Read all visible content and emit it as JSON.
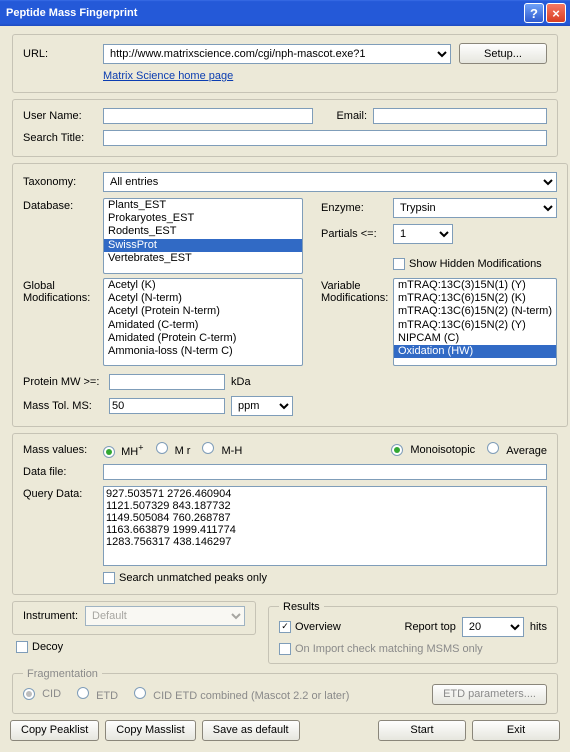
{
  "window": {
    "title": "Peptide Mass Fingerprint",
    "help": "?",
    "close": "×"
  },
  "url": {
    "label": "URL:",
    "value": "http://www.matrixscience.com/cgi/nph-mascot.exe?1",
    "setup": "Setup...",
    "link": "Matrix Science home page"
  },
  "user": {
    "name_label": "User Name:",
    "name_value": "",
    "email_label": "Email:",
    "email_value": "",
    "searchtitle_label": "Search Title:",
    "searchtitle_value": ""
  },
  "taxonomy": {
    "label": "Taxonomy:",
    "value": "All entries"
  },
  "database": {
    "label": "Database:",
    "items": [
      "Plants_EST",
      "Prokaryotes_EST",
      "Rodents_EST",
      "SwissProt",
      "Vertebrates_EST"
    ],
    "selected": "SwissProt"
  },
  "enzyme": {
    "label": "Enzyme:",
    "value": "Trypsin"
  },
  "partials": {
    "label": "Partials <=:",
    "value": "1"
  },
  "showhidden": {
    "label": "Show Hidden Modifications",
    "checked": false
  },
  "globalmods": {
    "label": "Global\nModifications:",
    "items": [
      "Acetyl (K)",
      "Acetyl (N-term)",
      "Acetyl (Protein N-term)",
      "Amidated (C-term)",
      "Amidated (Protein C-term)",
      "Ammonia-loss (N-term C)"
    ]
  },
  "varmods": {
    "label": "Variable\nModifications:",
    "items": [
      "mTRAQ:13C(3)15N(1) (Y)",
      "mTRAQ:13C(6)15N(2) (K)",
      "mTRAQ:13C(6)15N(2) (N-term)",
      "mTRAQ:13C(6)15N(2) (Y)",
      "NIPCAM (C)",
      "Oxidation (HW)"
    ]
  },
  "proteinmw": {
    "label": "Protein MW >=:",
    "value": "",
    "unit": "kDa"
  },
  "masstol": {
    "label": "Mass Tol. MS:",
    "value": "50",
    "unit": "ppm"
  },
  "massvalues": {
    "label": "Mass values:",
    "opts": {
      "mhplus": "MH",
      "mr": "M r",
      "mminush": "M-H"
    },
    "selected": "mhplus",
    "mono": "Monoisotopic",
    "avg": "Average",
    "mass_basis": "mono"
  },
  "datafile": {
    "label": "Data file:",
    "value": ""
  },
  "querydata": {
    "label": "Query Data:",
    "value": "927.503571 2726.460904\n1121.507329 843.187732\n1149.505084 760.268787\n1163.663879 1999.411774\n1283.756317 438.146297"
  },
  "unmatched": {
    "label": "Search unmatched peaks only",
    "checked": false
  },
  "instrument": {
    "label": "Instrument:",
    "value": "Default"
  },
  "decoy": {
    "label": "Decoy",
    "checked": false
  },
  "results": {
    "legend": "Results",
    "overview": "Overview",
    "overview_checked": true,
    "reporttop_label": "Report top",
    "reporttop_value": "20",
    "hits": "hits",
    "importcheck": "On Import check matching MSMS only"
  },
  "fragmentation": {
    "legend": "Fragmentation",
    "cid": "CID",
    "etd": "ETD",
    "combined": "CID ETD combined (Mascot 2.2 or later)",
    "etdparams": "ETD parameters...."
  },
  "buttons": {
    "copypeaklist": "Copy Peaklist",
    "copymasslist": "Copy Masslist",
    "saveasdefault": "Save as default",
    "start": "Start",
    "exit": "Exit"
  }
}
